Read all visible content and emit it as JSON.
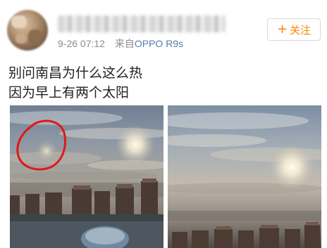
{
  "post": {
    "meta": {
      "time": "9-26 07:12",
      "source_prefix": "来自",
      "device": "OPPO R9s"
    },
    "follow_button": {
      "label": "关注",
      "plus": "+"
    },
    "text_lines": [
      "别问南昌为什么这么热",
      "因为早上有两个太阳"
    ],
    "images": [
      {
        "icon": "sky-photo-with-red-circle"
      },
      {
        "icon": "sky-photo"
      }
    ]
  },
  "colors": {
    "follow_accent": "#ff8200",
    "meta_gray": "#8c8c8c",
    "device_link": "#5b7bad",
    "annotation_red": "#e01818"
  }
}
